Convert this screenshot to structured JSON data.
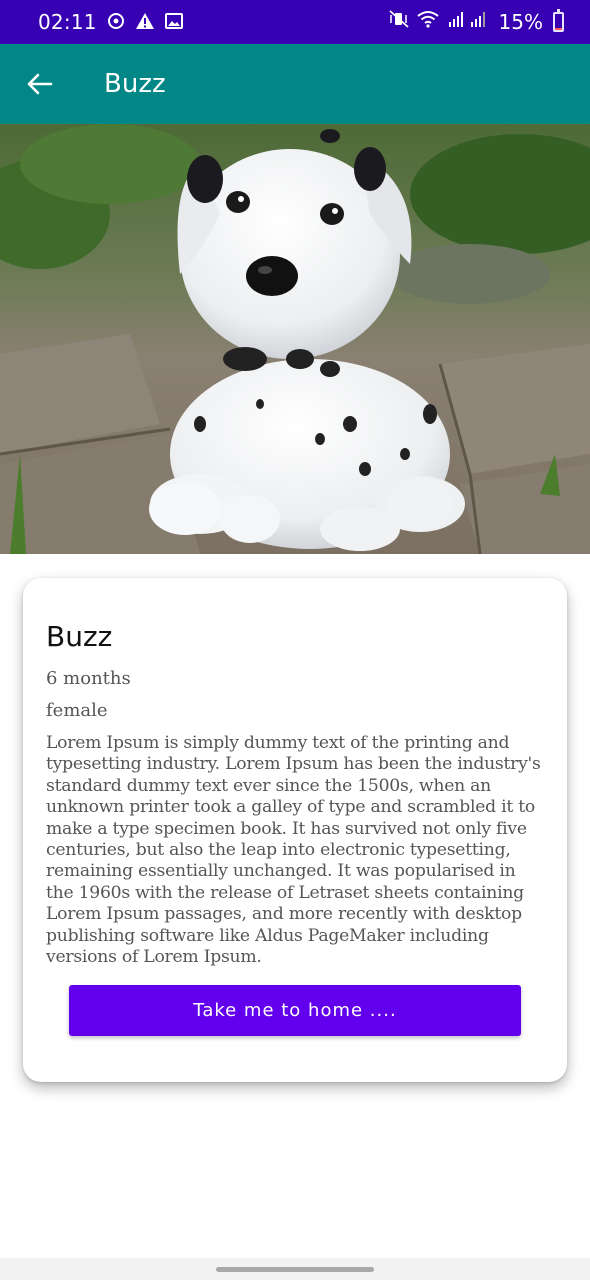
{
  "status_bar": {
    "time": "02:11",
    "battery_percent": "15%",
    "battery_level": 0.15,
    "background": "#3700b3",
    "icons_left": [
      "sync-icon",
      "warning-icon",
      "image-icon"
    ],
    "icons_right": [
      "mute-vibrate-icon",
      "wifi-icon",
      "signal-icon",
      "battery-icon"
    ]
  },
  "app_bar": {
    "title": "Buzz",
    "background": "#018786",
    "back_icon": "arrow-left-icon"
  },
  "hero": {
    "subject": "dalmatian-puppy"
  },
  "details": {
    "name": "Buzz",
    "age": "6 months",
    "gender": "female",
    "description": "Lorem Ipsum is simply dummy text of the printing and typesetting industry. Lorem Ipsum has been the industry's standard dummy text ever since the 1500s, when an unknown printer took a galley of type and scrambled it to make a type specimen book. It has survived not only five centuries, but also the leap into electronic typesetting, remaining essentially unchanged. It was popularised in the 1960s with the release of Letraset sheets containing Lorem Ipsum passages, and more recently with desktop publishing software like Aldus PageMaker including versions of Lorem Ipsum.",
    "home_button_label": "Take me to home ....",
    "button_color": "#6200ee"
  }
}
